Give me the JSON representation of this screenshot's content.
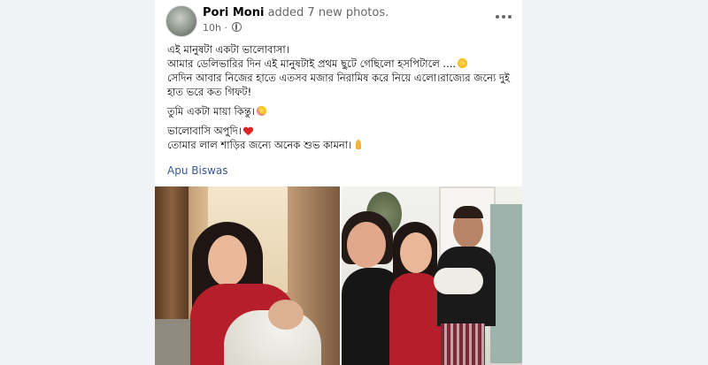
{
  "post": {
    "author": "Pori Moni",
    "action": "added 7 new photos.",
    "time": "10h",
    "lines": [
      "এই মানুষটা একটা ভালোবাসা।",
      "আমার ডেলিভারির দিন এই মানুষটাই প্রথম ছুটে গেছিলো হসপিটালে ....",
      "সেদিন আবার নিজের হাতে এতসব মজার নিরামিষ করে নিয়ে এলো।রাজ্যের জন্যে দুই হাত ভরে কত গিফট!",
      "তুমি একটা মায়া কিন্তু।",
      "ভালোবাসি অপুদি।",
      "তোমার লাল শাড়ির জন্যে অনেক শুভ কামনা।"
    ],
    "tagged": "Apu Biswas"
  },
  "icons": {
    "more": "more-horizontal-icon",
    "privacy": "globe-icon"
  },
  "colors": {
    "link": "#385898",
    "secondary_text": "#65676b",
    "background": "#f0f2f5"
  }
}
